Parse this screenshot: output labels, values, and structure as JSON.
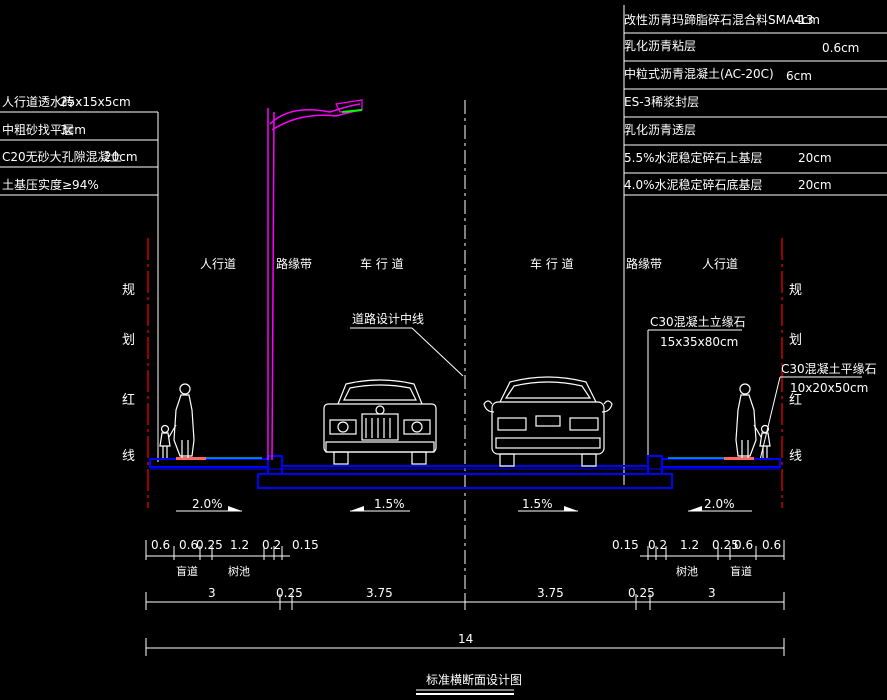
{
  "title": "标准横断面设计图",
  "right_layers": [
    {
      "name": "改性沥青玛蹄脂碎石混合料SMA-13",
      "thickness": "4cm"
    },
    {
      "name": "乳化沥青粘层",
      "thickness": "0.6cm"
    },
    {
      "name": "中粒式沥青混凝土(AC-20C)",
      "thickness": "6cm"
    },
    {
      "name": "ES-3稀浆封层",
      "thickness": ""
    },
    {
      "name": "乳化沥青透层",
      "thickness": ""
    },
    {
      "name": "5.5%水泥稳定碎石上基层",
      "thickness": "20cm"
    },
    {
      "name": "4.0%水泥稳定碎石底基层",
      "thickness": "20cm"
    }
  ],
  "left_layers": [
    {
      "name": "人行道透水砖",
      "thickness": "25x15x5cm"
    },
    {
      "name": "中粗砂找平层",
      "thickness": "3cm"
    },
    {
      "name": "C20无砂大孔隙混凝土",
      "thickness": "20cm"
    },
    {
      "name": "土基压实度≥94%",
      "thickness": ""
    }
  ],
  "zones": {
    "sidewalk": "人行道",
    "curb_belt": "路缘带",
    "carriageway": "车 行 道"
  },
  "red_line": [
    "规",
    "划",
    "红",
    "线"
  ],
  "centerline_label": "道路设计中线",
  "curb_upright": {
    "name": "C30混凝土立缘石",
    "size": "15x35x80cm"
  },
  "curb_flat": {
    "name": "C30混凝土平缘石",
    "size": "10x20x50cm"
  },
  "slopes": {
    "sidewalk": "2.0%",
    "lane": "1.5%"
  },
  "dims_detail_left": [
    "0.6",
    "0.6",
    "0.25",
    "1.2",
    "0.2",
    "0.15"
  ],
  "dims_detail_right": [
    "0.15",
    "0.2",
    "1.2",
    "0.25",
    "0.6",
    "0.6"
  ],
  "detail_labels": {
    "blind_path": "盲道",
    "tree_pool": "树池"
  },
  "dims_main": [
    "3",
    "0.25",
    "3.75",
    "3.75",
    "0.25",
    "3"
  ],
  "total_width": "14",
  "colors": {
    "background": "#000000",
    "lamp": "#ff00ff",
    "road": "#0000ff",
    "red_line": "#ff0000",
    "lamp_head": "#00ff00"
  },
  "icons": [
    "street-lamp-icon",
    "car-front-icon",
    "pedestrian-icon"
  ]
}
